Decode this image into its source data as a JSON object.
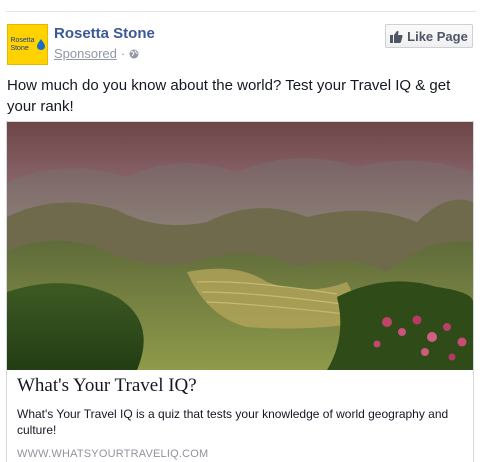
{
  "post": {
    "page_name": "Rosetta Stone",
    "logo_text_line1": "Rosetta",
    "logo_text_line2": "Stone",
    "sponsored_label": "Sponsored",
    "separator": "·",
    "audience_icon": "globe-icon",
    "like_button_label": "Like Page",
    "like_icon": "thumbs-up-icon",
    "message": "How much do you know about the world? Test your Travel IQ & get your rank!"
  },
  "link_card": {
    "image_description_icon": "landscape-photo",
    "title": "What's Your Travel IQ?",
    "description": "What's Your Travel IQ is a quiz that tests your knowledge of world geography and culture!",
    "domain": "WWW.WHATSYOURTRAVELIQ.COM"
  },
  "colors": {
    "link_blue": "#3b5998",
    "meta_gray": "#9197a3",
    "logo_yellow": "#ffd200"
  }
}
